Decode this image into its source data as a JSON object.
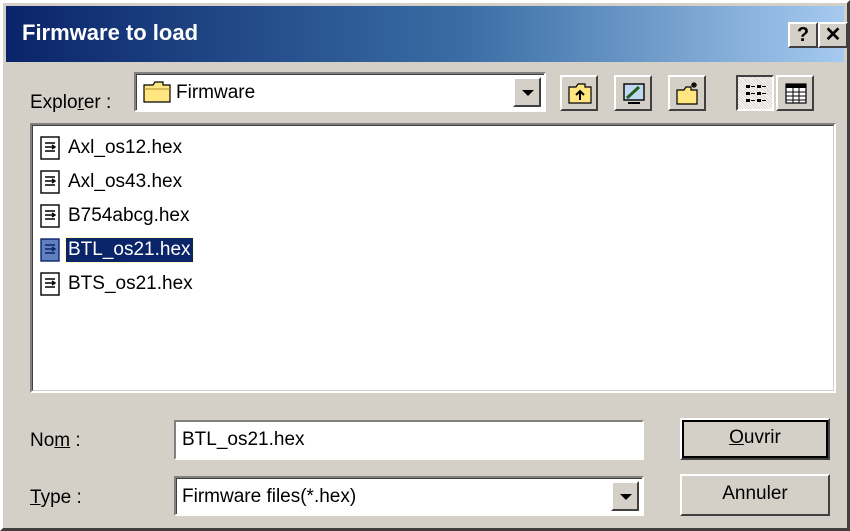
{
  "window": {
    "title": "Firmware to load",
    "help_label": "?",
    "close_label": "✕"
  },
  "lookin": {
    "label_pre": "Explo",
    "label_accel": "r",
    "label_post": "er :",
    "value": "Firmware"
  },
  "toolbar": {
    "icons": [
      "up-folder-icon",
      "desktop-icon",
      "new-folder-icon",
      "list-view-icon",
      "details-view-icon"
    ]
  },
  "files": [
    {
      "name": "Axl_os12.hex",
      "selected": false
    },
    {
      "name": "Axl_os43.hex",
      "selected": false
    },
    {
      "name": "B754abcg.hex",
      "selected": false
    },
    {
      "name": "BTL_os21.hex",
      "selected": true
    },
    {
      "name": "BTS_os21.hex",
      "selected": false
    }
  ],
  "form": {
    "name_label_pre": "No",
    "name_label_accel": "m",
    "name_label_post": " :",
    "name_value": "BTL_os21.hex",
    "type_label_accel": "T",
    "type_label_post": "ype :",
    "type_value": "Firmware files(*.hex)"
  },
  "buttons": {
    "open_accel": "O",
    "open_rest": "uvrir",
    "cancel": "Annuler"
  },
  "colors": {
    "titlebar_start": "#0a246a",
    "titlebar_end": "#a6caf0",
    "selection": "#0a246a",
    "face": "#d4d0c8"
  }
}
